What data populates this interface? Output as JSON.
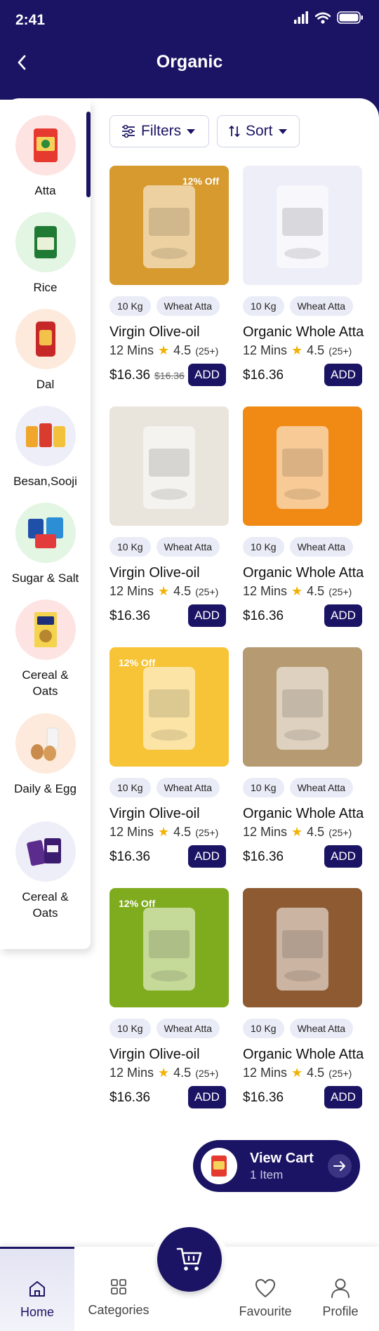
{
  "status_bar": {
    "time": "2:41"
  },
  "header": {
    "title": "Organic"
  },
  "categories": [
    {
      "label": "Atta"
    },
    {
      "label": "Rice"
    },
    {
      "label": "Dal"
    },
    {
      "label": "Besan,Sooji"
    },
    {
      "label": "Sugar & Salt"
    },
    {
      "label": "Cereal &\nOats"
    },
    {
      "label": "Daily & Egg"
    },
    {
      "label": "Cereal &\nOats"
    }
  ],
  "toolbar": {
    "filters_label": "Filters",
    "sort_label": "Sort"
  },
  "products": [
    {
      "badge": "12% Off",
      "weight": "10 Kg",
      "type": "Wheat Atta",
      "name": "Virgin Olive-oil",
      "time": "12 Mins",
      "rating": "4.5",
      "rating_count": "(25+)",
      "price": "$16.36",
      "old_price": "$16.36",
      "add_label": "ADD",
      "color": "#d79a2e"
    },
    {
      "badge": "",
      "weight": "10 Kg",
      "type": "Wheat Atta",
      "name": "Organic Whole Atta",
      "time": "12 Mins",
      "rating": "4.5",
      "rating_count": "(25+)",
      "price": "$16.36",
      "old_price": "",
      "add_label": "ADD",
      "color": "#eeeef8"
    },
    {
      "badge": "",
      "weight": "10 Kg",
      "type": "Wheat Atta",
      "name": "Virgin Olive-oil",
      "time": "12 Mins",
      "rating": "4.5",
      "rating_count": "(25+)",
      "price": "$16.36",
      "old_price": "",
      "add_label": "ADD",
      "color": "#e9e4dc"
    },
    {
      "badge": "",
      "weight": "10 Kg",
      "type": "Wheat Atta",
      "name": "Organic Whole Atta",
      "time": "12 Mins",
      "rating": "4.5",
      "rating_count": "(25+)",
      "price": "$16.36",
      "old_price": "",
      "add_label": "ADD",
      "color": "#f08a14"
    },
    {
      "badge": "12% Off",
      "weight": "10 Kg",
      "type": "Wheat Atta",
      "name": "Virgin Olive-oil",
      "time": "12 Mins",
      "rating": "4.5",
      "rating_count": "(25+)",
      "price": "$16.36",
      "old_price": "",
      "add_label": "ADD",
      "color": "#f7c438"
    },
    {
      "badge": "",
      "weight": "10 Kg",
      "type": "Wheat Atta",
      "name": "Organic Whole Atta",
      "time": "12 Mins",
      "rating": "4.5",
      "rating_count": "(25+)",
      "price": "$16.36",
      "old_price": "",
      "add_label": "ADD",
      "color": "#b59a72"
    },
    {
      "badge": "12% Off",
      "weight": "10 Kg",
      "type": "Wheat Atta",
      "name": "Virgin Olive-oil",
      "time": "12 Mins",
      "rating": "4.5",
      "rating_count": "(25+)",
      "price": "$16.36",
      "old_price": "",
      "add_label": "ADD",
      "color": "#7fab1e"
    },
    {
      "badge": "",
      "weight": "10 Kg",
      "type": "Wheat Atta",
      "name": "Organic Whole Atta",
      "time": "12 Mins",
      "rating": "4.5",
      "rating_count": "(25+)",
      "price": "$16.36",
      "old_price": "",
      "add_label": "ADD",
      "color": "#8d5a32"
    }
  ],
  "view_cart": {
    "title": "View Cart",
    "subtitle": "1 Item"
  },
  "bottom_nav": {
    "home": "Home",
    "categories": "Categories",
    "favourite": "Favourite",
    "profile": "Profile"
  },
  "theme": {
    "primary": "#1b1464",
    "accent_star": "#f2b203"
  }
}
